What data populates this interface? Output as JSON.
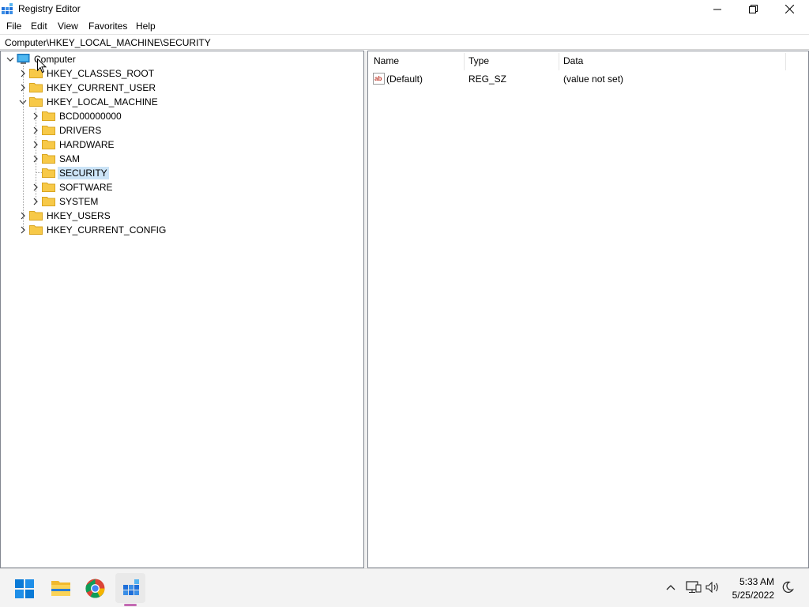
{
  "window": {
    "title": "Registry Editor"
  },
  "menu": [
    "File",
    "Edit",
    "View",
    "Favorites",
    "Help"
  ],
  "address": "Computer\\HKEY_LOCAL_MACHINE\\SECURITY",
  "tree": {
    "root": "Computer",
    "hives": [
      {
        "label": "HKEY_CLASSES_ROOT",
        "expanded": false
      },
      {
        "label": "HKEY_CURRENT_USER",
        "expanded": false
      },
      {
        "label": "HKEY_LOCAL_MACHINE",
        "expanded": true
      },
      {
        "label": "HKEY_USERS",
        "expanded": false
      },
      {
        "label": "HKEY_CURRENT_CONFIG",
        "expanded": false
      }
    ],
    "hklm_children": [
      {
        "label": "BCD00000000",
        "has_children": true
      },
      {
        "label": "DRIVERS",
        "has_children": true
      },
      {
        "label": "HARDWARE",
        "has_children": true
      },
      {
        "label": "SAM",
        "has_children": true
      },
      {
        "label": "SECURITY",
        "has_children": false,
        "selected": true
      },
      {
        "label": "SOFTWARE",
        "has_children": true
      },
      {
        "label": "SYSTEM",
        "has_children": true
      }
    ]
  },
  "list": {
    "columns": [
      "Name",
      "Type",
      "Data"
    ],
    "rows": [
      {
        "name": "(Default)",
        "type": "REG_SZ",
        "data": "(value not set)",
        "icon": "string-value-icon"
      }
    ]
  },
  "taskbar": {
    "apps": [
      "start-icon",
      "file-explorer-icon",
      "chrome-icon",
      "registry-editor-icon"
    ],
    "active_app": "registry-editor-icon",
    "tray_icons": [
      "chevron-up-icon",
      "network-icon",
      "volume-icon",
      "focus-assist-icon"
    ],
    "time": "5:33 AM",
    "date": "5/25/2022"
  },
  "colors": {
    "selection": "#cce4f7",
    "folder": "#f7c948",
    "accent": "#0078d4"
  }
}
